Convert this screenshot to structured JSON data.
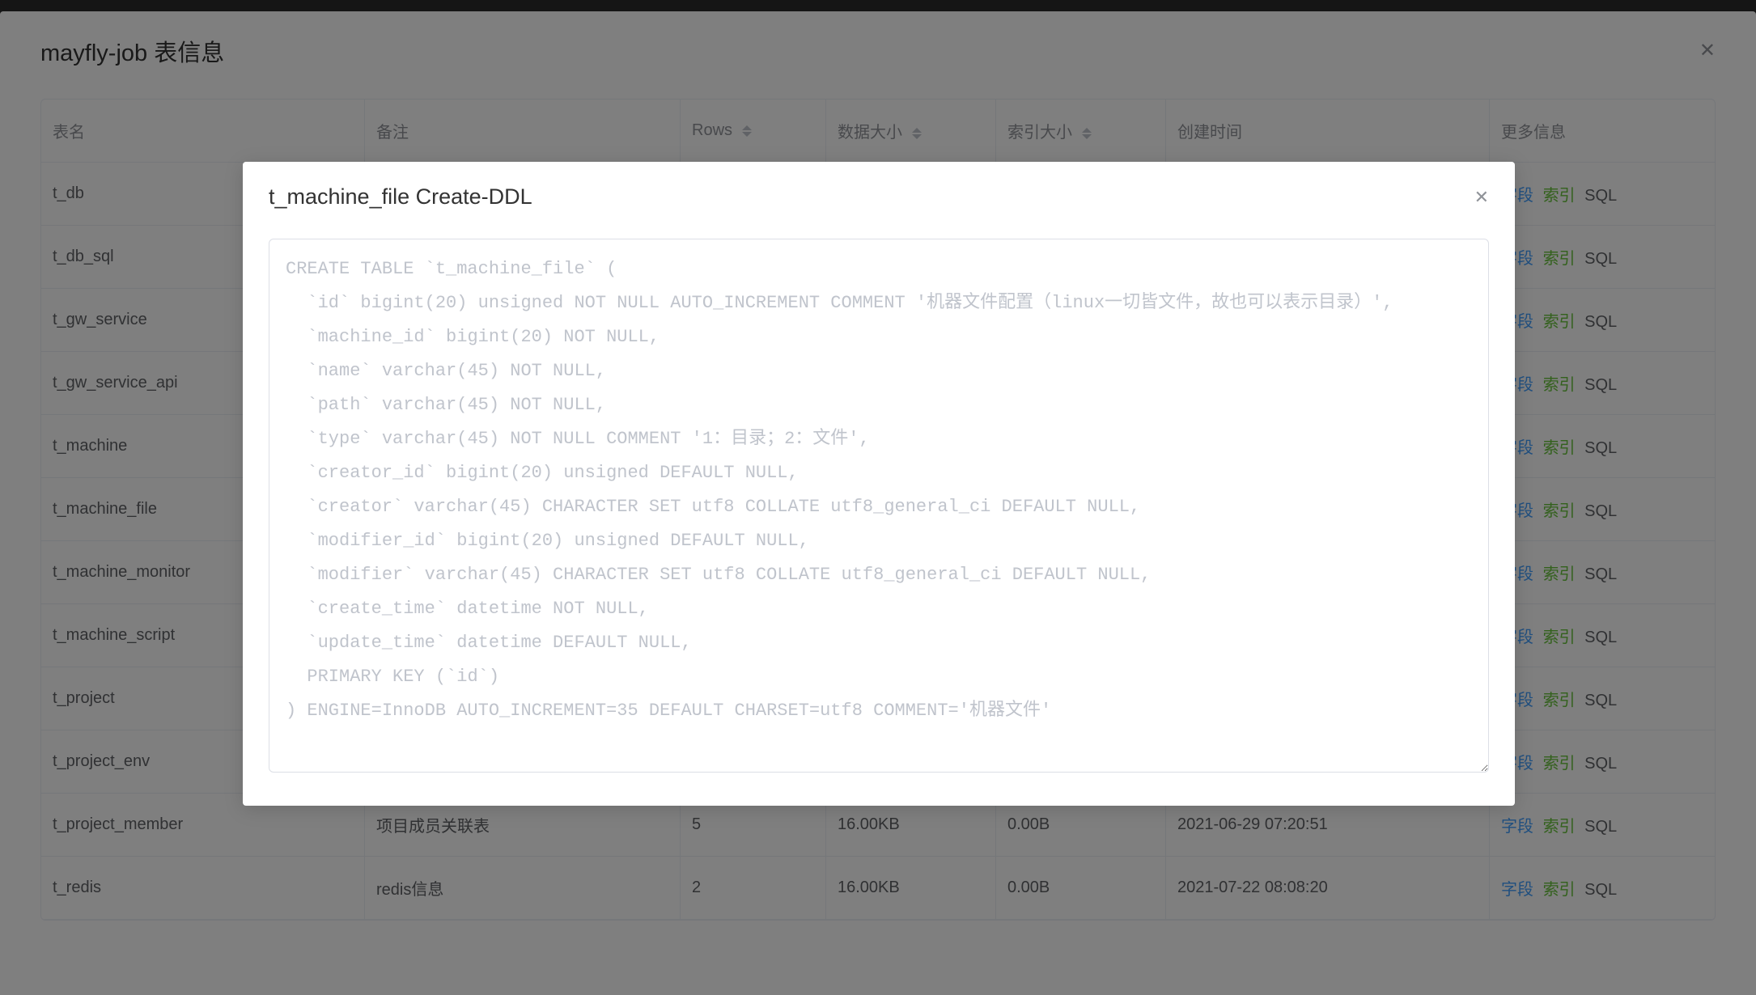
{
  "main_dialog": {
    "title": "mayfly-job 表信息"
  },
  "columns": {
    "name": "表名",
    "comment": "备注",
    "rows": "Rows",
    "data_size": "数据大小",
    "index_size": "索引大小",
    "created": "创建时间",
    "more": "更多信息"
  },
  "links": {
    "fields": "字段",
    "indexes": "索引",
    "sql": "SQL"
  },
  "rows": [
    {
      "name": "t_db",
      "comment": "",
      "rows": "",
      "data_size": "",
      "index_size": "",
      "created": ""
    },
    {
      "name": "t_db_sql",
      "comment": "",
      "rows": "",
      "data_size": "",
      "index_size": "",
      "created": ""
    },
    {
      "name": "t_gw_service",
      "comment": "",
      "rows": "",
      "data_size": "",
      "index_size": "",
      "created": ""
    },
    {
      "name": "t_gw_service_api",
      "comment": "",
      "rows": "",
      "data_size": "",
      "index_size": "",
      "created": ""
    },
    {
      "name": "t_machine",
      "comment": "",
      "rows": "",
      "data_size": "",
      "index_size": "",
      "created": ""
    },
    {
      "name": "t_machine_file",
      "comment": "",
      "rows": "",
      "data_size": "",
      "index_size": "",
      "created": ""
    },
    {
      "name": "t_machine_monitor",
      "comment": "",
      "rows": "",
      "data_size": "",
      "index_size": "",
      "created": ""
    },
    {
      "name": "t_machine_script",
      "comment": "",
      "rows": "",
      "data_size": "",
      "index_size": "",
      "created": ""
    },
    {
      "name": "t_project",
      "comment": "",
      "rows": "",
      "data_size": "",
      "index_size": "",
      "created": ""
    },
    {
      "name": "t_project_env",
      "comment": "",
      "rows": "",
      "data_size": "",
      "index_size": "",
      "created": ""
    },
    {
      "name": "t_project_member",
      "comment": "项目成员关联表",
      "rows": "5",
      "data_size": "16.00KB",
      "index_size": "0.00B",
      "created": "2021-06-29 07:20:51"
    },
    {
      "name": "t_redis",
      "comment": "redis信息",
      "rows": "2",
      "data_size": "16.00KB",
      "index_size": "0.00B",
      "created": "2021-07-22 08:08:20"
    }
  ],
  "ddl_modal": {
    "title": "t_machine_file Create-DDL",
    "sql": "CREATE TABLE `t_machine_file` (\n  `id` bigint(20) unsigned NOT NULL AUTO_INCREMENT COMMENT '机器文件配置（linux一切皆文件，故也可以表示目录）',\n  `machine_id` bigint(20) NOT NULL,\n  `name` varchar(45) NOT NULL,\n  `path` varchar(45) NOT NULL,\n  `type` varchar(45) NOT NULL COMMENT '1：目录；2：文件',\n  `creator_id` bigint(20) unsigned DEFAULT NULL,\n  `creator` varchar(45) CHARACTER SET utf8 COLLATE utf8_general_ci DEFAULT NULL,\n  `modifier_id` bigint(20) unsigned DEFAULT NULL,\n  `modifier` varchar(45) CHARACTER SET utf8 COLLATE utf8_general_ci DEFAULT NULL,\n  `create_time` datetime NOT NULL,\n  `update_time` datetime DEFAULT NULL,\n  PRIMARY KEY (`id`)\n) ENGINE=InnoDB AUTO_INCREMENT=35 DEFAULT CHARSET=utf8 COMMENT='机器文件'"
  }
}
